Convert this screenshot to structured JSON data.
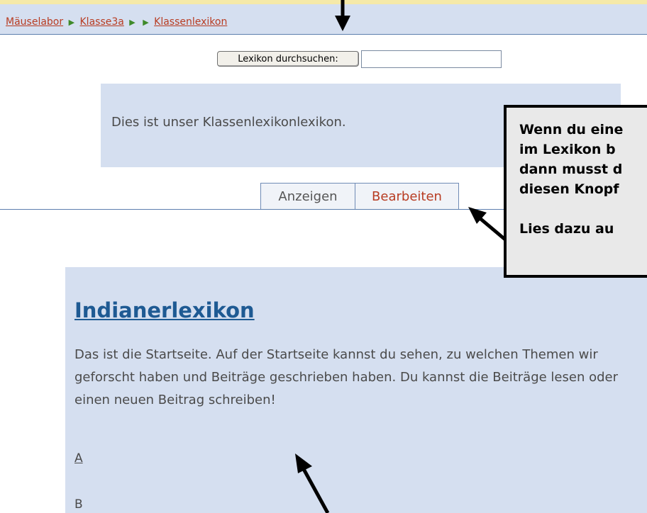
{
  "breadcrumb": {
    "items": [
      "Mäuselabor",
      "Klasse3a",
      "Klassenlexikon"
    ],
    "separator": "▶"
  },
  "search": {
    "button_label": "Lexikon durchsuchen:",
    "input_value": ""
  },
  "intro": {
    "text": "Dies ist unser Klassenlexikonlexikon."
  },
  "tabs": [
    {
      "label": "Anzeigen"
    },
    {
      "label": "Bearbeiten"
    }
  ],
  "callout": {
    "lines": [
      "Wenn du eine",
      "im Lexikon b",
      "dann musst d",
      "diesen Knopf"
    ],
    "extra": "Lies dazu au"
  },
  "content": {
    "title": "Indianerlexikon",
    "text": "Das ist die Startseite. Auf der Startseite kannst du sehen, zu welchen Themen wir geforscht haben und Beiträge geschrieben haben. Du kannst die Beiträge lesen oder einen neuen Beitrag schreiben!",
    "letters": [
      "A",
      "B"
    ]
  },
  "colors": {
    "panel_bg": "#d5dff0",
    "link": "#b83c22",
    "title_link": "#1e5a93",
    "divider": "#5d7fae"
  }
}
